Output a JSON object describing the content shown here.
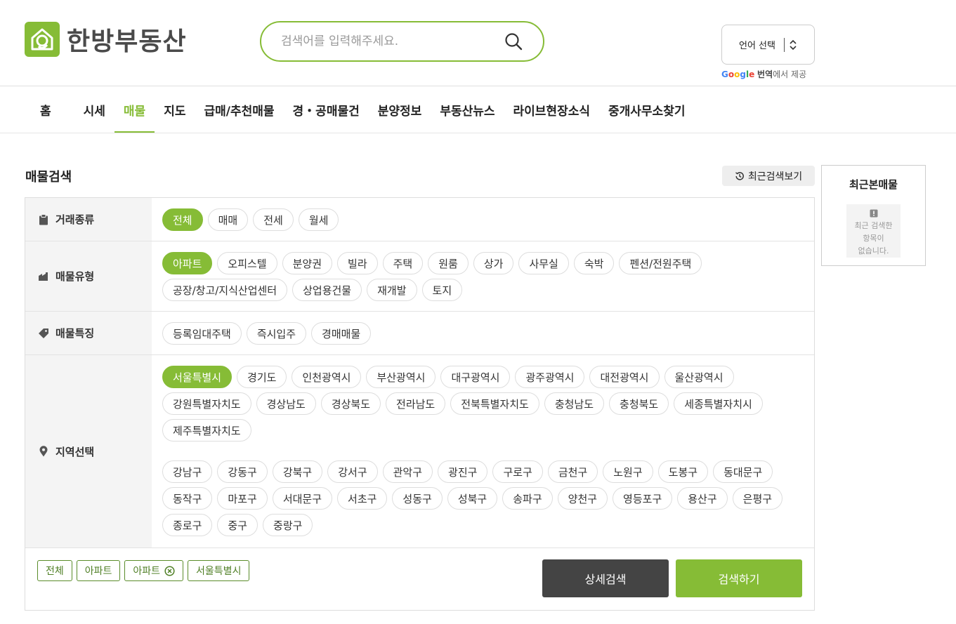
{
  "header": {
    "logo_text": "한방부동산",
    "search_placeholder": "검색어를 입력해주세요.",
    "lang_label": "언어 선택",
    "google_suffix": "에서 제공",
    "google_word": "번역"
  },
  "nav": [
    "홈",
    "시세",
    "매물",
    "지도",
    "급매/추천매물",
    "경・공매물건",
    "분양정보",
    "부동산뉴스",
    "라이브현장소식",
    "중개사무소찾기"
  ],
  "nav_active": "매물",
  "section": {
    "title": "매물검색",
    "recent_search_label": "최근검색보기"
  },
  "filters": {
    "deal_type": {
      "label": "거래종류",
      "options": [
        "전체",
        "매매",
        "전세",
        "월세"
      ]
    },
    "property_type": {
      "label": "매물유형",
      "options": [
        "아파트",
        "오피스텔",
        "분양권",
        "빌라",
        "주택",
        "원룸",
        "상가",
        "사무실",
        "숙박",
        "펜션/전원주택",
        "공장/창고/지식산업센터",
        "상업용건물",
        "재개발",
        "토지"
      ]
    },
    "feature": {
      "label": "매물특징",
      "options": [
        "등록임대주택",
        "즉시입주",
        "경매매물"
      ]
    },
    "region": {
      "label": "지역선택",
      "cities": [
        "서울특별시",
        "경기도",
        "인천광역시",
        "부산광역시",
        "대구광역시",
        "광주광역시",
        "대전광역시",
        "울산광역시",
        "강원특별자치도",
        "경상남도",
        "경상북도",
        "전라남도",
        "전북특별자치도",
        "충청남도",
        "충청북도",
        "세종특별자치시",
        "제주특별자치도"
      ],
      "districts": [
        "강남구",
        "강동구",
        "강북구",
        "강서구",
        "관악구",
        "광진구",
        "구로구",
        "금천구",
        "노원구",
        "도봉구",
        "동대문구",
        "동작구",
        "마포구",
        "서대문구",
        "서초구",
        "성동구",
        "성북구",
        "송파구",
        "양천구",
        "영등포구",
        "용산구",
        "은평구",
        "종로구",
        "중구",
        "중랑구"
      ]
    }
  },
  "selected_tags": [
    "전체",
    "아파트",
    "아파트",
    "서울특별시"
  ],
  "buttons": {
    "detail": "상세검색",
    "search": "검색하기"
  },
  "recent_viewed": {
    "title": "최근본매물",
    "empty_lines": [
      "최근 검색한",
      "항목이",
      "없습니다."
    ]
  },
  "colors": {
    "accent": "#86bc36",
    "dark_button": "#444444"
  }
}
